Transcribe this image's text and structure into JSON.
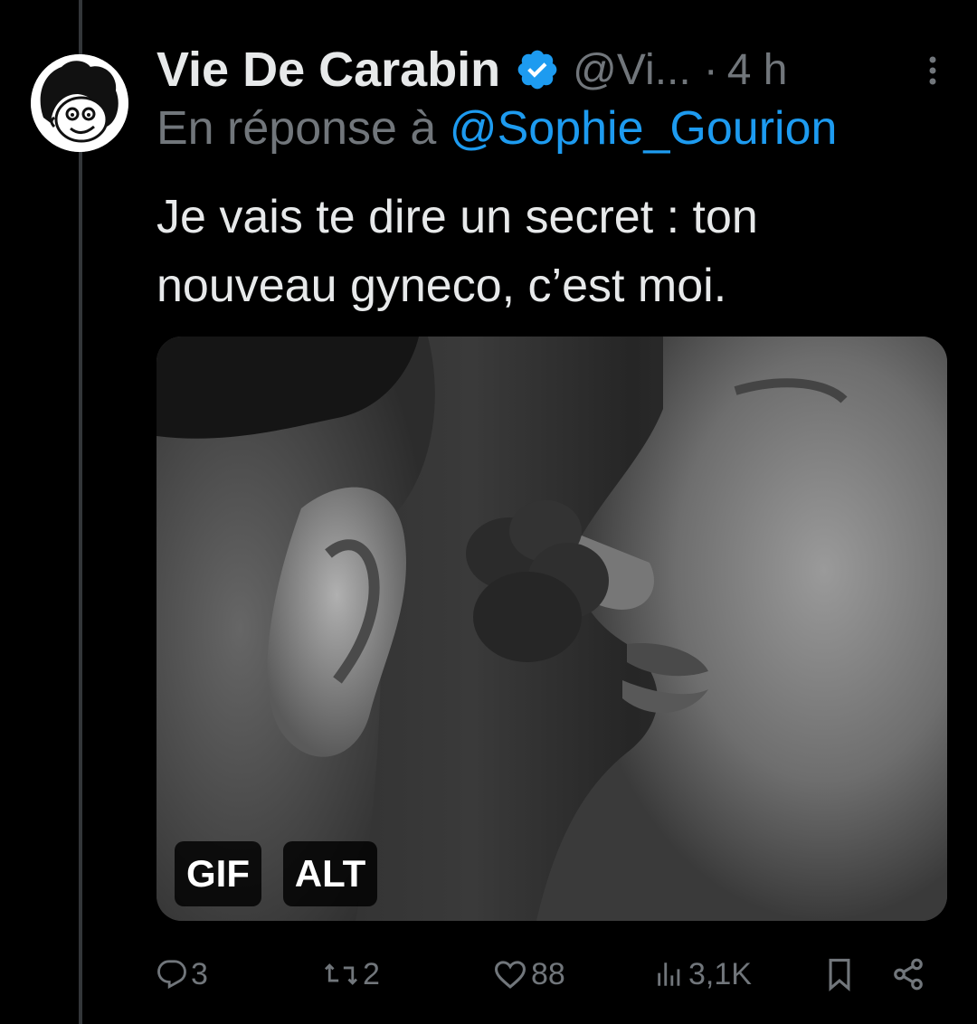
{
  "tweet": {
    "author_name": "Vie De Carabin",
    "handle": "@Vi...",
    "separator": "·",
    "time": "4 h",
    "reply_prefix": "En réponse à",
    "reply_mention": "@Sophie_Gourion",
    "text_line1": "Je vais te dire un secret : ton",
    "text_line2": "nouveau gyneco, c’est moi.",
    "media": {
      "gif_badge": "GIF",
      "alt_badge": "ALT"
    },
    "actions": {
      "replies": "3",
      "retweets": "2",
      "likes": "88",
      "views": "3,1K"
    },
    "icons": [
      "reply-icon",
      "retweet-icon",
      "like-icon",
      "views-icon",
      "bookmark-icon",
      "share-icon",
      "verified-badge-icon",
      "more-options-icon"
    ],
    "colors": {
      "background": "#000000",
      "text": "#e7e9ea",
      "secondary": "#71767b",
      "link": "#1d9bf0",
      "verified": "#1d9bf0"
    }
  }
}
